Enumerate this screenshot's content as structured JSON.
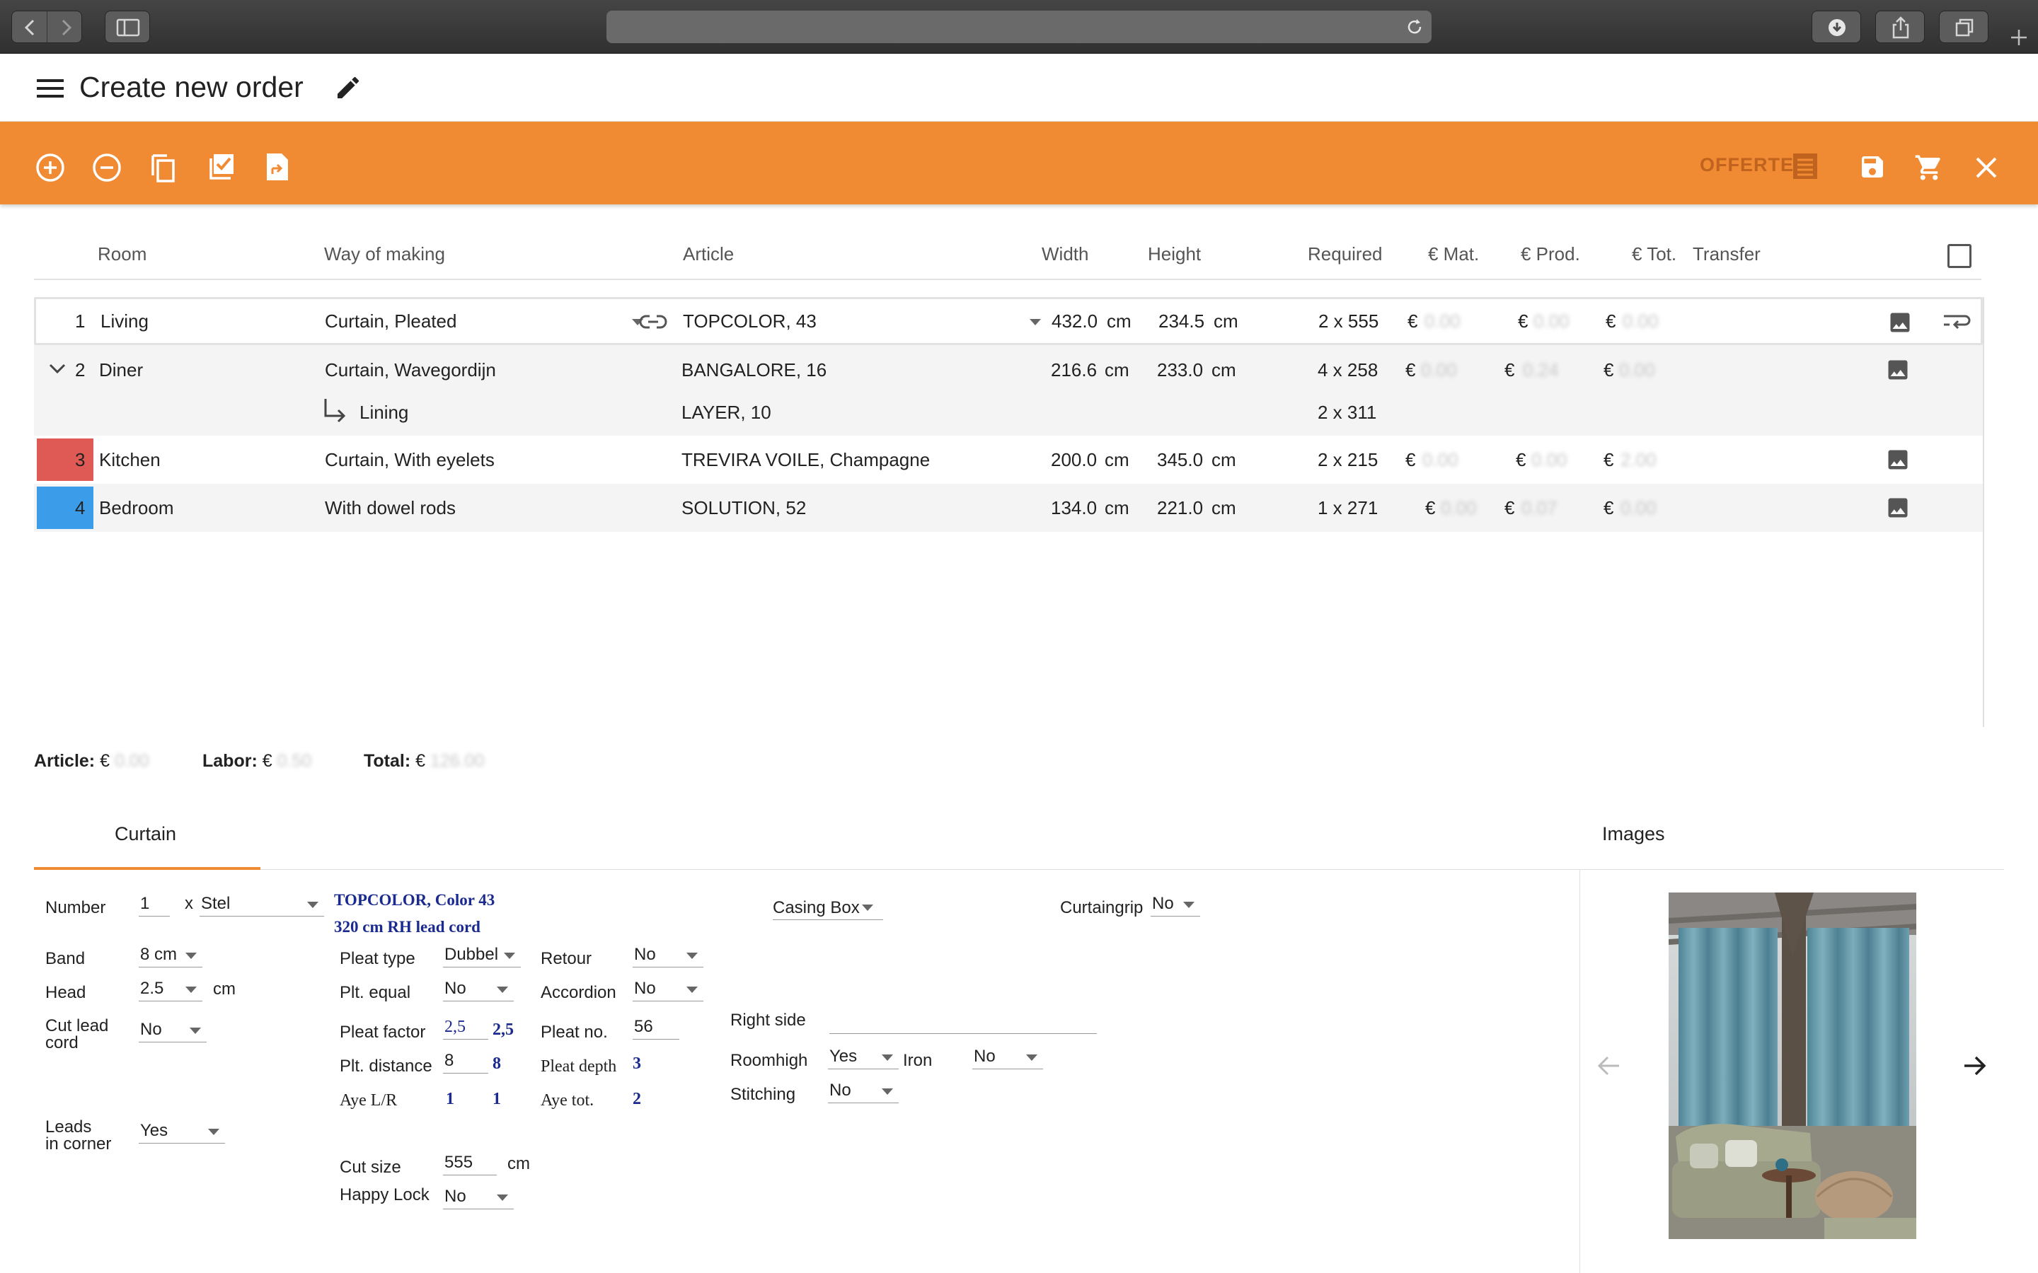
{
  "app": {
    "title": "Create new order"
  },
  "toolbar": {
    "offerte_label": "OFFERTE",
    "accent_color": "#f08b33"
  },
  "table": {
    "headers": [
      "Room",
      "Way of making",
      "Article",
      "Width",
      "Height",
      "Required",
      "€ Mat.",
      "€ Prod.",
      "€ Tot.",
      "Transfer"
    ],
    "rows": [
      {
        "num": "1",
        "room": "Living",
        "way": "Curtain, Pleated",
        "article": "TOPCOLOR, 43",
        "width": "432.0",
        "height": "234.5",
        "unit": "cm",
        "required": "2 x 555",
        "cur": "€",
        "mat": "0.00",
        "prod": "0.00",
        "tot": "0.00"
      },
      {
        "num": "2",
        "room": "Diner",
        "way": "Curtain, Wavegordijn",
        "article": "BANGALORE, 16",
        "width": "216.6",
        "height": "233.0",
        "unit": "cm",
        "required": "4 x 258",
        "cur": "€",
        "mat": "0.00",
        "prod": "0.24",
        "tot": "0.00"
      },
      {
        "way": "Lining",
        "article": "LAYER, 10",
        "required": "2 x 311"
      },
      {
        "num": "3",
        "room": "Kitchen",
        "way": "Curtain, With eyelets",
        "article": "TREVIRA VOILE, Champagne",
        "width": "200.0",
        "height": "345.0",
        "unit": "cm",
        "required": "2 x 215",
        "cur": "€",
        "mat": "0.00",
        "prod": "0.00",
        "tot": "2.00",
        "color": "#e05a55"
      },
      {
        "num": "4",
        "room": "Bedroom",
        "way": "With dowel rods",
        "article": "SOLUTION, 52",
        "width": "134.0",
        "height": "221.0",
        "unit": "cm",
        "required": "1 x 271",
        "cur": "€",
        "mat": "0.00",
        "prod": "0.07",
        "tot": "0.00",
        "color": "#3b9ce9"
      }
    ]
  },
  "totals": {
    "article_label": "Article:",
    "article_value": "0.00",
    "labor_label": "Labor:",
    "labor_value": "0.50",
    "total_label": "Total:",
    "total_value": "126.00",
    "currency": "€"
  },
  "tabs": {
    "curtain": "Curtain",
    "images": "Images"
  },
  "form": {
    "number_label": "Number",
    "number_value": "1",
    "x_label": "x",
    "stel_value": "Stel",
    "article_line1": "TOPCOLOR, Color 43",
    "article_line2": "320 cm RH lead cord",
    "band_label": "Band",
    "band_value": "8 cm",
    "head_label": "Head",
    "head_value": "2.5",
    "cm_label": "cm",
    "cutlead_label1": "Cut lead",
    "cutlead_label2": "cord",
    "cutlead_value": "No",
    "leads_label1": "Leads",
    "leads_label2": "in corner",
    "leads_value": "Yes",
    "pleat_type_label": "Pleat type",
    "pleat_type_value": "Dubbel",
    "plt_equal_label": "Plt. equal",
    "plt_equal_value": "No",
    "pleat_factor_label": "Pleat factor",
    "pleat_factor_value": "2,5",
    "pleat_factor_calc": "2,5",
    "plt_distance_label": "Plt. distance",
    "plt_distance_value": "8",
    "plt_distance_calc": "8",
    "aye_lr_label": "Aye L/R",
    "aye_l": "1",
    "aye_r": "1",
    "retour_label": "Retour",
    "retour_value": "No",
    "accordion_label": "Accordion",
    "accordion_value": "No",
    "pleat_no_label": "Pleat no.",
    "pleat_no_value": "56",
    "pleat_depth_label": "Pleat depth",
    "pleat_depth_value": "3",
    "aye_tot_label": "Aye tot.",
    "aye_tot_value": "2",
    "cut_size_label": "Cut size",
    "cut_size_value": "555",
    "cut_size_unit": "cm",
    "happy_lock_label": "Happy Lock",
    "happy_lock_value": "No",
    "casing_label": "Casing Box",
    "curtaingrip_label": "Curtaingrip",
    "curtaingrip_value": "No",
    "right_side_label": "Right side",
    "right_side_value": "",
    "roomhigh_label": "Roomhigh",
    "roomhigh_value": "Yes",
    "iron_label": "Iron",
    "iron_value": "No",
    "stitching_label": "Stitching",
    "stitching_value": "No"
  }
}
